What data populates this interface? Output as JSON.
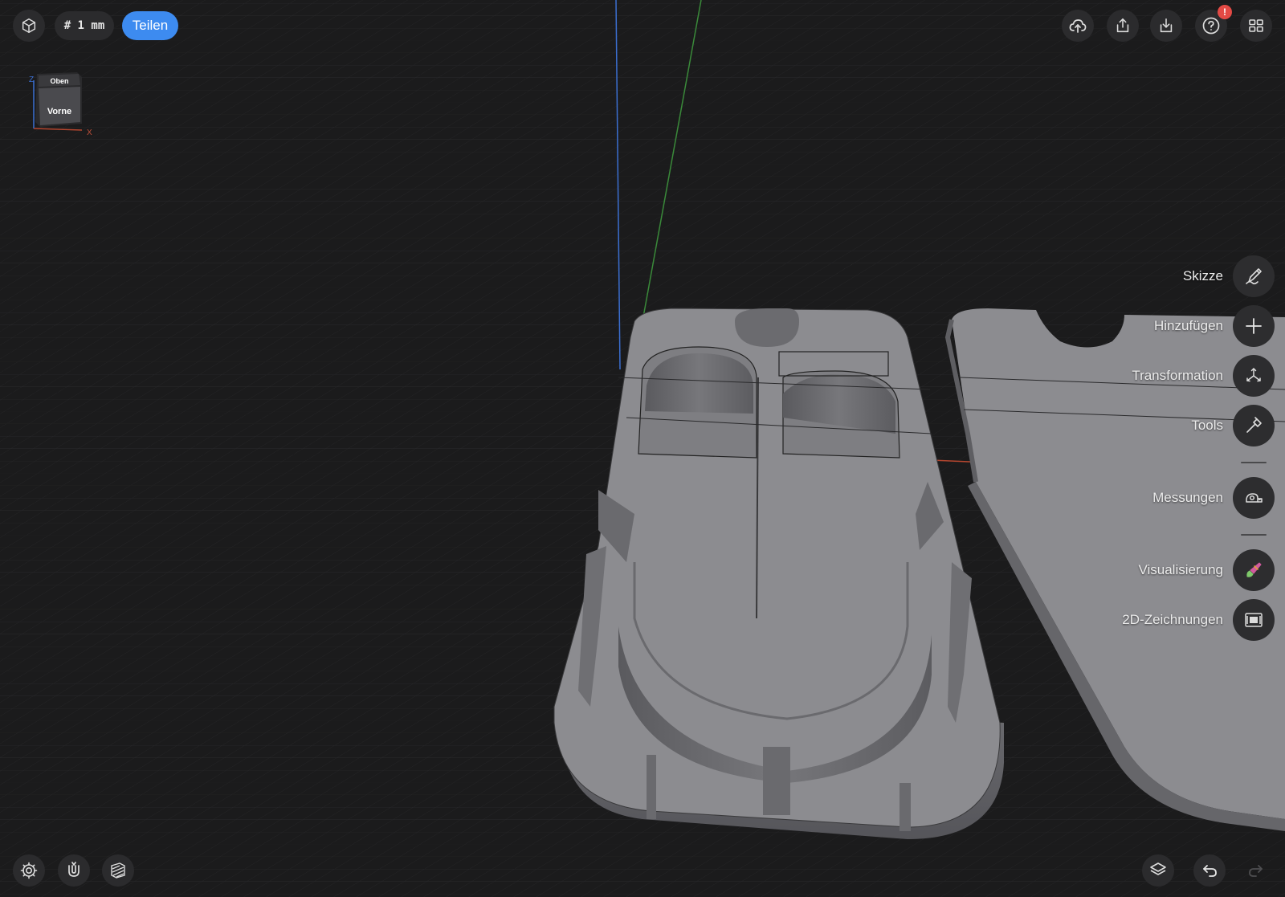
{
  "toolbar": {
    "grid_label": "# 1 mm",
    "share_label": "Teilen",
    "help_badge": "!"
  },
  "viewcube": {
    "top_face": "Oben",
    "front_face": "Vorne",
    "axis_z": "Z",
    "axis_x": "X"
  },
  "side_menu": {
    "items": [
      {
        "label": "Skizze",
        "icon": "sketch-pencil-icon"
      },
      {
        "label": "Hinzufügen",
        "icon": "plus-icon"
      },
      {
        "label": "Transformation",
        "icon": "transform-arrows-icon"
      },
      {
        "label": "Tools",
        "icon": "hammer-icon"
      },
      {
        "label": "Messungen",
        "icon": "tape-measure-icon"
      },
      {
        "label": "Visualisierung",
        "icon": "paint-brush-icon"
      },
      {
        "label": "2D-Zeichnungen",
        "icon": "drawing-sheet-icon"
      }
    ]
  },
  "colors": {
    "background": "#1b1b1c",
    "accent": "#3d8bf0",
    "badge": "#e34a45",
    "model": "#8a8a8e"
  }
}
